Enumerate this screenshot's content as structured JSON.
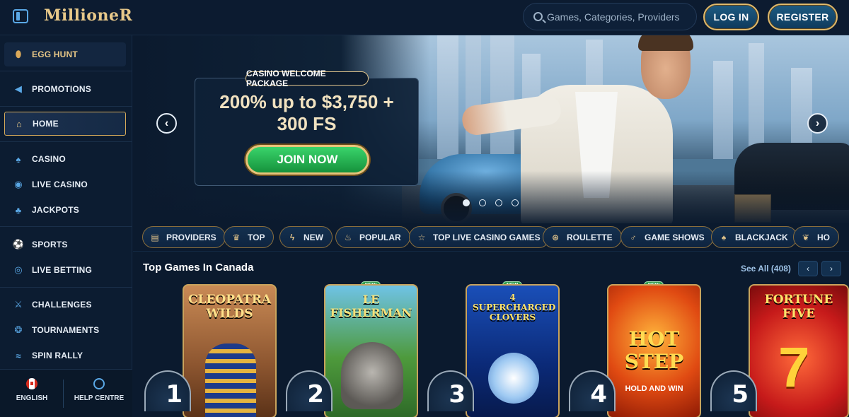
{
  "header": {
    "logo_text": "MillioneR",
    "search_placeholder": "Games, Categories, Providers",
    "login_label": "LOG IN",
    "register_label": "REGISTER"
  },
  "sidebar": {
    "items": [
      {
        "label": "EGG HUNT",
        "icon": "egg-icon"
      },
      {
        "label": "PROMOTIONS",
        "icon": "megaphone-icon"
      },
      {
        "label": "HOME",
        "icon": "home-icon",
        "active": true
      },
      {
        "label": "CASINO",
        "icon": "spade-icon"
      },
      {
        "label": "LIVE CASINO",
        "icon": "chip-icon"
      },
      {
        "label": "JACKPOTS",
        "icon": "clover-icon"
      },
      {
        "label": "SPORTS",
        "icon": "soccer-ball-icon"
      },
      {
        "label": "LIVE BETTING",
        "icon": "live-bet-icon"
      },
      {
        "label": "CHALLENGES",
        "icon": "swords-icon"
      },
      {
        "label": "TOURNAMENTS",
        "icon": "medal-icon"
      },
      {
        "label": "SPIN RALLY",
        "icon": "wings-icon"
      }
    ],
    "footer": {
      "language": "ENGLISH",
      "help": "HELP CENTRE"
    }
  },
  "hero": {
    "tag": "CASINO WELCOME PACKAGE",
    "title_line1": "200% up to $3,750 +",
    "title_line2": "300 FS",
    "cta": "JOIN NOW",
    "slides_total": 4,
    "active_slide": 1
  },
  "categories": [
    {
      "label": "PROVIDERS",
      "icon": "book-icon"
    },
    {
      "label": "TOP",
      "icon": "crown-icon"
    },
    {
      "label": "NEW",
      "icon": "lightning-icon"
    },
    {
      "label": "POPULAR",
      "icon": "flame-icon"
    },
    {
      "label": "TOP LIVE CASINO GAMES",
      "icon": "star-icon"
    },
    {
      "label": "ROULETTE",
      "icon": "roulette-icon"
    },
    {
      "label": "GAME SHOWS",
      "icon": "microphone-icon"
    },
    {
      "label": "BLACKJACK",
      "icon": "cards-icon"
    },
    {
      "label": "HO",
      "icon": "leaf-icon"
    }
  ],
  "top_games": {
    "title": "Top Games In Canada",
    "see_all": "See All (408)",
    "games": [
      {
        "rank": "1",
        "title": "CLEOPATRA WILDS",
        "new": false
      },
      {
        "rank": "2",
        "title": "LE FISHERMAN",
        "new": true
      },
      {
        "rank": "3",
        "title": "4 SUPERCHARGED CLOVERS",
        "new": true
      },
      {
        "rank": "4",
        "title": "HOT STEP",
        "subtitle": "HOLD AND WIN",
        "new": true
      },
      {
        "rank": "5",
        "title": "FORTUNE FIVE",
        "new": false
      }
    ],
    "new_badge": "NEW"
  }
}
